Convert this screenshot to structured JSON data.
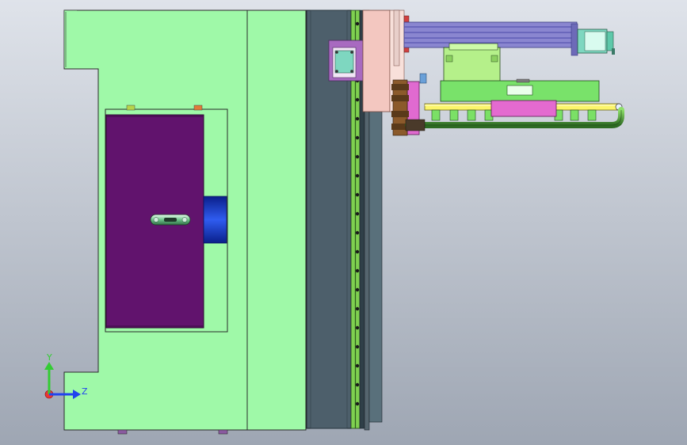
{
  "viewport": {
    "background_top": "#dfe3ea",
    "background_bottom": "#9ea6b3"
  },
  "colors": {
    "frame_green": "#9ff9a8",
    "door_purple": "#61136d",
    "spindle_blue": "#1a3fd0",
    "column_gray": "#4d5f6b",
    "rail_green": "#7fd050",
    "motor_bracket": "#a86ac0",
    "motor_teal": "#7ed7c0",
    "purple_rails": "#8a86d0",
    "salmon_plate": "#f3c7c0",
    "magenta_block": "#e06ad0",
    "yellow_rod": "#fbf56a",
    "green_tube": "#4f9d3c",
    "axis_y": "#33cc33",
    "axis_z": "#2244ee",
    "axis_x": "#ee2222"
  },
  "triad": {
    "y_label": "Y",
    "z_label": "Z"
  }
}
